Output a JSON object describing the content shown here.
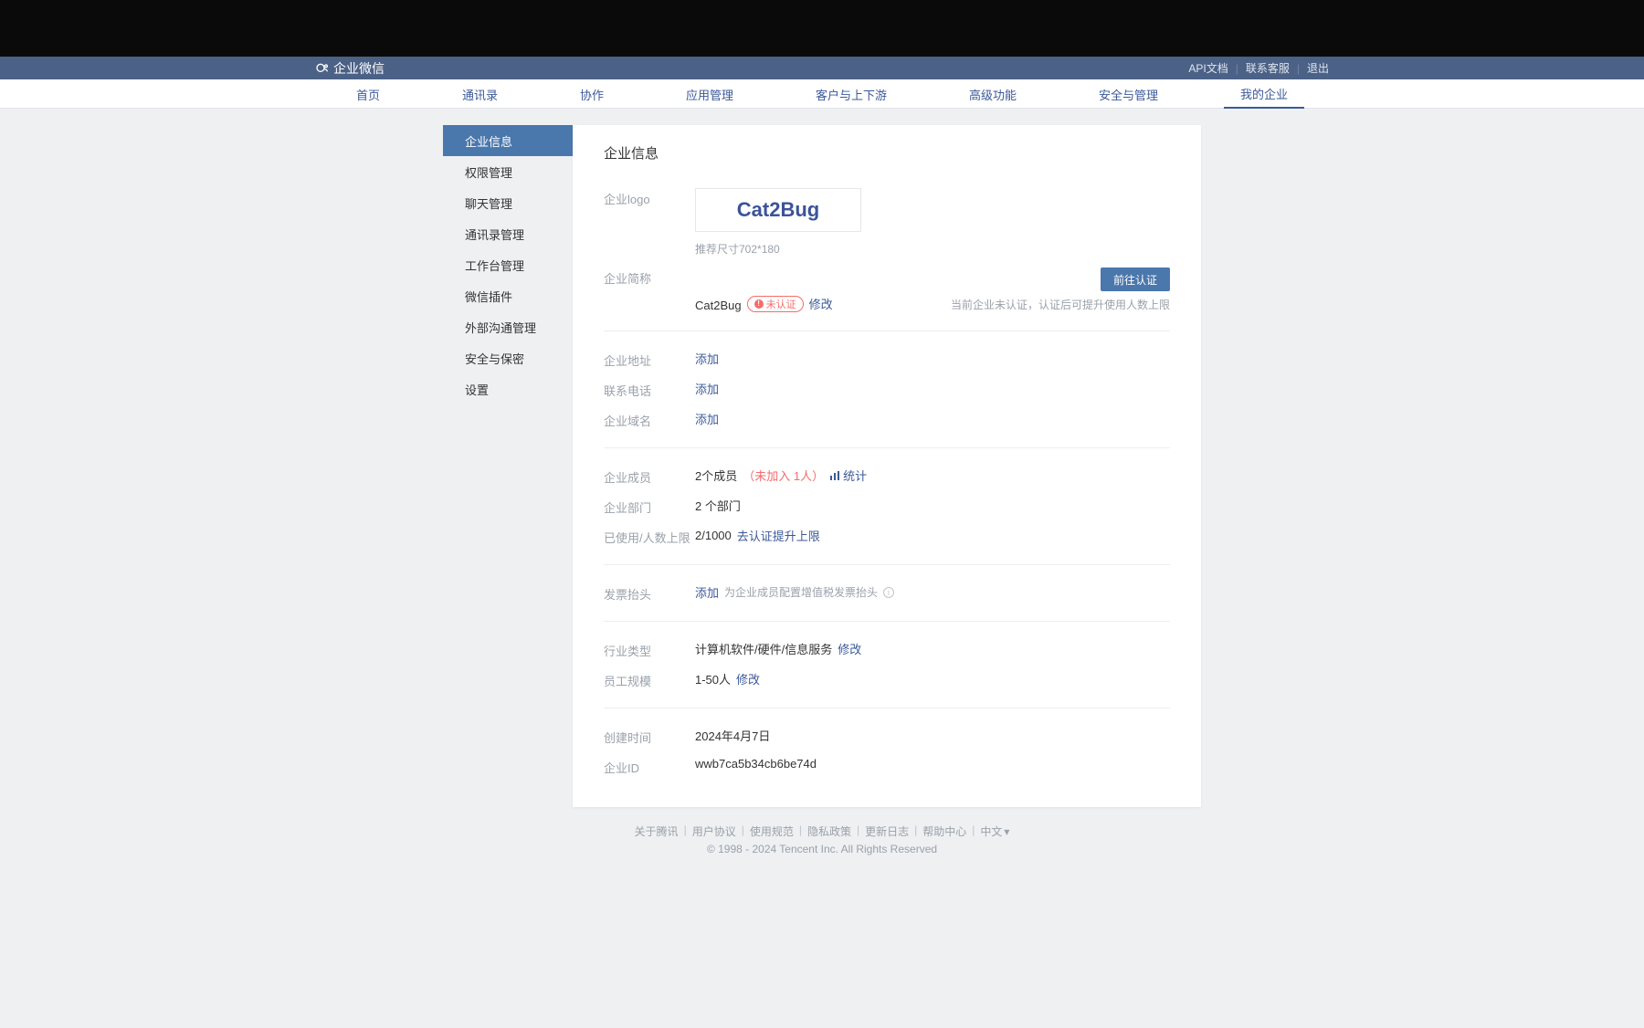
{
  "brand_name": "企业微信",
  "top_links": {
    "api_docs": "API文档",
    "contact": "联系客服",
    "logout": "退出"
  },
  "main_nav": [
    "首页",
    "通讯录",
    "协作",
    "应用管理",
    "客户与上下游",
    "高级功能",
    "安全与管理",
    "我的企业"
  ],
  "main_nav_active_index": 7,
  "sidebar": {
    "items": [
      "企业信息",
      "权限管理",
      "聊天管理",
      "通讯录管理",
      "工作台管理",
      "微信插件",
      "外部沟通管理",
      "安全与保密",
      "设置"
    ],
    "active_index": 0
  },
  "page_title": "企业信息",
  "logo": {
    "label": "企业logo",
    "text": "Cat2Bug",
    "size_hint": "推荐尺寸702*180"
  },
  "short_name": {
    "label": "企业简称",
    "value": "Cat2Bug",
    "badge_text": "未认证",
    "modify": "修改",
    "cert_btn": "前往认证",
    "cert_note": "当前企业未认证，认证后可提升使用人数上限"
  },
  "address": {
    "label": "企业地址",
    "add": "添加"
  },
  "phone": {
    "label": "联系电话",
    "add": "添加"
  },
  "domain": {
    "label": "企业域名",
    "add": "添加"
  },
  "members": {
    "label": "企业成员",
    "count_text": "2个成员",
    "pending_text": "（未加入 1人）",
    "stats_text": "统计"
  },
  "departments": {
    "label": "企业部门",
    "value": "2 个部门"
  },
  "usage": {
    "label": "已使用/人数上限",
    "value": "2/1000",
    "upgrade_link": "去认证提升上限"
  },
  "invoice": {
    "label": "发票抬头",
    "add": "添加",
    "hint": "为企业成员配置增值税发票抬头"
  },
  "industry": {
    "label": "行业类型",
    "value": "计算机软件/硬件/信息服务",
    "modify": "修改"
  },
  "scale": {
    "label": "员工规模",
    "value": "1-50人",
    "modify": "修改"
  },
  "created": {
    "label": "创建时间",
    "value": "2024年4月7日"
  },
  "company_id": {
    "label": "企业ID",
    "value": "wwb7ca5b34cb6be74d"
  },
  "footer": {
    "links": [
      "关于腾讯",
      "用户协议",
      "使用规范",
      "隐私政策",
      "更新日志",
      "帮助中心"
    ],
    "language": "中文",
    "copyright": "© 1998 - 2024 Tencent Inc. All Rights Reserved"
  }
}
